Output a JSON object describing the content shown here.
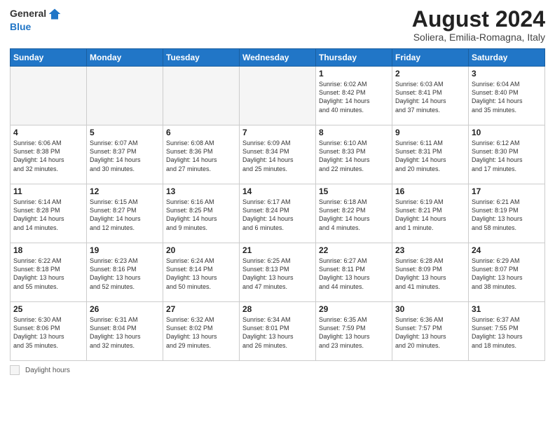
{
  "header": {
    "logo_general": "General",
    "logo_blue": "Blue",
    "month_year": "August 2024",
    "location": "Soliera, Emilia-Romagna, Italy"
  },
  "days_of_week": [
    "Sunday",
    "Monday",
    "Tuesday",
    "Wednesday",
    "Thursday",
    "Friday",
    "Saturday"
  ],
  "weeks": [
    [
      {
        "day": "",
        "info": ""
      },
      {
        "day": "",
        "info": ""
      },
      {
        "day": "",
        "info": ""
      },
      {
        "day": "",
        "info": ""
      },
      {
        "day": "1",
        "info": "Sunrise: 6:02 AM\nSunset: 8:42 PM\nDaylight: 14 hours\nand 40 minutes."
      },
      {
        "day": "2",
        "info": "Sunrise: 6:03 AM\nSunset: 8:41 PM\nDaylight: 14 hours\nand 37 minutes."
      },
      {
        "day": "3",
        "info": "Sunrise: 6:04 AM\nSunset: 8:40 PM\nDaylight: 14 hours\nand 35 minutes."
      }
    ],
    [
      {
        "day": "4",
        "info": "Sunrise: 6:06 AM\nSunset: 8:38 PM\nDaylight: 14 hours\nand 32 minutes."
      },
      {
        "day": "5",
        "info": "Sunrise: 6:07 AM\nSunset: 8:37 PM\nDaylight: 14 hours\nand 30 minutes."
      },
      {
        "day": "6",
        "info": "Sunrise: 6:08 AM\nSunset: 8:36 PM\nDaylight: 14 hours\nand 27 minutes."
      },
      {
        "day": "7",
        "info": "Sunrise: 6:09 AM\nSunset: 8:34 PM\nDaylight: 14 hours\nand 25 minutes."
      },
      {
        "day": "8",
        "info": "Sunrise: 6:10 AM\nSunset: 8:33 PM\nDaylight: 14 hours\nand 22 minutes."
      },
      {
        "day": "9",
        "info": "Sunrise: 6:11 AM\nSunset: 8:31 PM\nDaylight: 14 hours\nand 20 minutes."
      },
      {
        "day": "10",
        "info": "Sunrise: 6:12 AM\nSunset: 8:30 PM\nDaylight: 14 hours\nand 17 minutes."
      }
    ],
    [
      {
        "day": "11",
        "info": "Sunrise: 6:14 AM\nSunset: 8:28 PM\nDaylight: 14 hours\nand 14 minutes."
      },
      {
        "day": "12",
        "info": "Sunrise: 6:15 AM\nSunset: 8:27 PM\nDaylight: 14 hours\nand 12 minutes."
      },
      {
        "day": "13",
        "info": "Sunrise: 6:16 AM\nSunset: 8:25 PM\nDaylight: 14 hours\nand 9 minutes."
      },
      {
        "day": "14",
        "info": "Sunrise: 6:17 AM\nSunset: 8:24 PM\nDaylight: 14 hours\nand 6 minutes."
      },
      {
        "day": "15",
        "info": "Sunrise: 6:18 AM\nSunset: 8:22 PM\nDaylight: 14 hours\nand 4 minutes."
      },
      {
        "day": "16",
        "info": "Sunrise: 6:19 AM\nSunset: 8:21 PM\nDaylight: 14 hours\nand 1 minute."
      },
      {
        "day": "17",
        "info": "Sunrise: 6:21 AM\nSunset: 8:19 PM\nDaylight: 13 hours\nand 58 minutes."
      }
    ],
    [
      {
        "day": "18",
        "info": "Sunrise: 6:22 AM\nSunset: 8:18 PM\nDaylight: 13 hours\nand 55 minutes."
      },
      {
        "day": "19",
        "info": "Sunrise: 6:23 AM\nSunset: 8:16 PM\nDaylight: 13 hours\nand 52 minutes."
      },
      {
        "day": "20",
        "info": "Sunrise: 6:24 AM\nSunset: 8:14 PM\nDaylight: 13 hours\nand 50 minutes."
      },
      {
        "day": "21",
        "info": "Sunrise: 6:25 AM\nSunset: 8:13 PM\nDaylight: 13 hours\nand 47 minutes."
      },
      {
        "day": "22",
        "info": "Sunrise: 6:27 AM\nSunset: 8:11 PM\nDaylight: 13 hours\nand 44 minutes."
      },
      {
        "day": "23",
        "info": "Sunrise: 6:28 AM\nSunset: 8:09 PM\nDaylight: 13 hours\nand 41 minutes."
      },
      {
        "day": "24",
        "info": "Sunrise: 6:29 AM\nSunset: 8:07 PM\nDaylight: 13 hours\nand 38 minutes."
      }
    ],
    [
      {
        "day": "25",
        "info": "Sunrise: 6:30 AM\nSunset: 8:06 PM\nDaylight: 13 hours\nand 35 minutes."
      },
      {
        "day": "26",
        "info": "Sunrise: 6:31 AM\nSunset: 8:04 PM\nDaylight: 13 hours\nand 32 minutes."
      },
      {
        "day": "27",
        "info": "Sunrise: 6:32 AM\nSunset: 8:02 PM\nDaylight: 13 hours\nand 29 minutes."
      },
      {
        "day": "28",
        "info": "Sunrise: 6:34 AM\nSunset: 8:01 PM\nDaylight: 13 hours\nand 26 minutes."
      },
      {
        "day": "29",
        "info": "Sunrise: 6:35 AM\nSunset: 7:59 PM\nDaylight: 13 hours\nand 23 minutes."
      },
      {
        "day": "30",
        "info": "Sunrise: 6:36 AM\nSunset: 7:57 PM\nDaylight: 13 hours\nand 20 minutes."
      },
      {
        "day": "31",
        "info": "Sunrise: 6:37 AM\nSunset: 7:55 PM\nDaylight: 13 hours\nand 18 minutes."
      }
    ]
  ],
  "legend": {
    "box_label": "Daylight hours"
  }
}
